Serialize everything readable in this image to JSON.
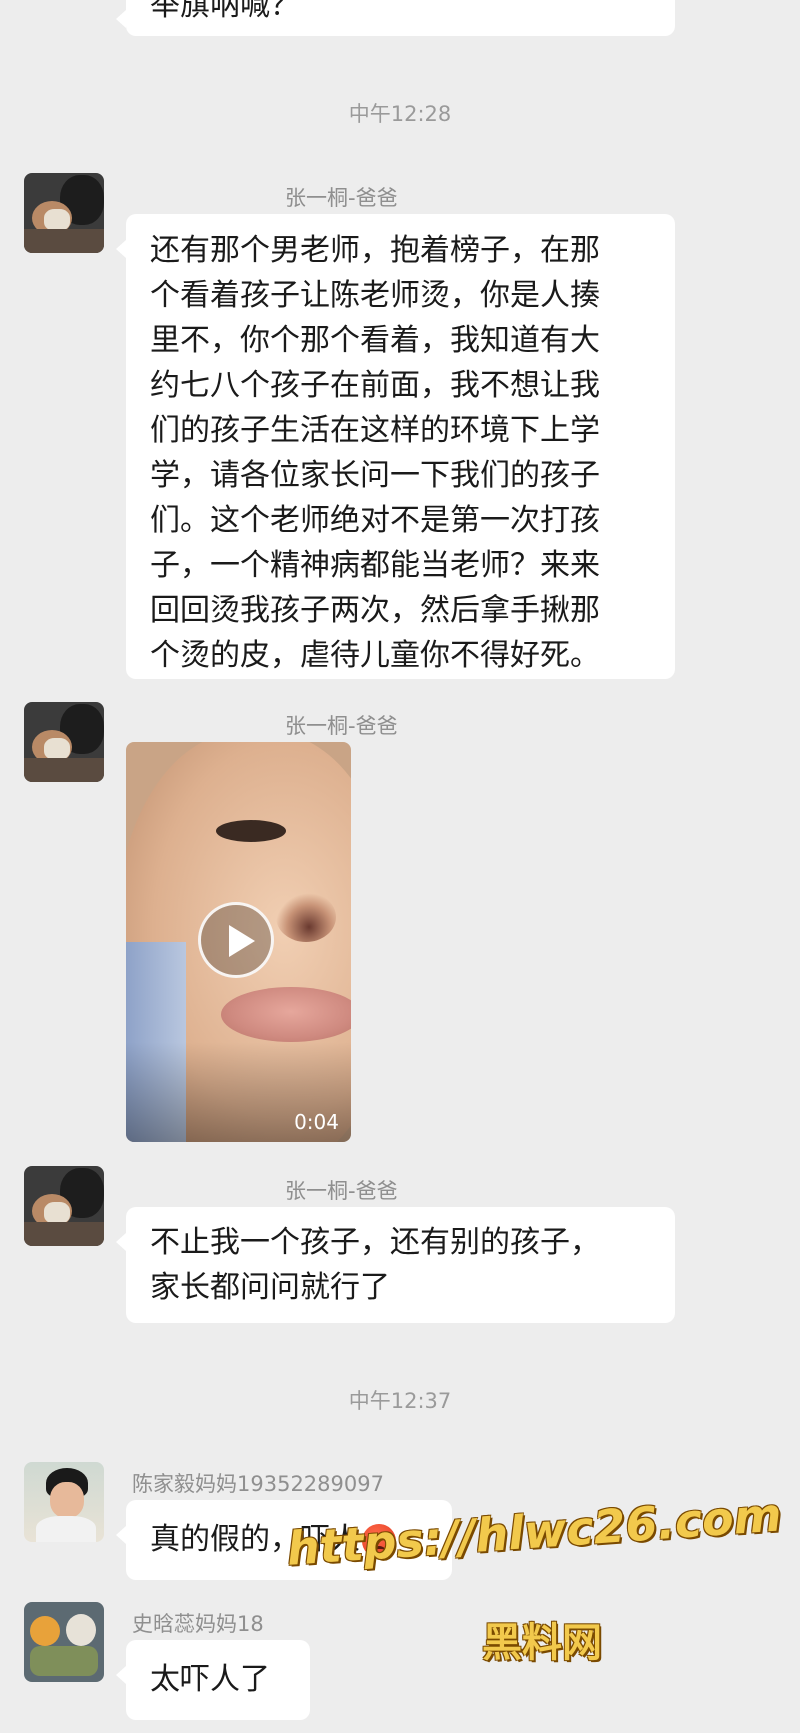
{
  "prev_bubble": {
    "text": "举旗呐喊？"
  },
  "timestamps": [
    "中午12:28",
    "中午12:37"
  ],
  "messages": [
    {
      "sender": "张一桐-爸爸",
      "lines": [
        "还有那个男老师，抱着榜子，在那",
        "个看着孩子让陈老师烫，你是人揍",
        "里不，你个那个看着，我知道有大",
        "约七八个孩子在前面，我不想让我",
        "们的孩子生活在这样的环境下上学",
        "学，请各位家长问一下我们的孩子",
        "们。这个老师绝对不是第一次打孩",
        "子，一个精神病都能当老师？来来",
        "回回烫我孩子两次，然后拿手揪那",
        "个烫的皮，虐待儿童你不得好死。"
      ]
    },
    {
      "sender": "张一桐-爸爸",
      "video_duration": "0:04",
      "play_icon": "play-icon"
    },
    {
      "sender": "张一桐-爸爸",
      "lines": [
        "不止我一个孩子，还有别的孩子，",
        "家长都问问就行了"
      ]
    },
    {
      "sender": "陈家毅妈妈19352289097",
      "text": "真的假的，吓人",
      "emoji": "angry-face-icon"
    },
    {
      "sender": "史晗蕊妈妈18",
      "text": "太吓人了"
    }
  ],
  "watermark": {
    "url": "https://hlwc26.com",
    "name": "黑料网"
  }
}
